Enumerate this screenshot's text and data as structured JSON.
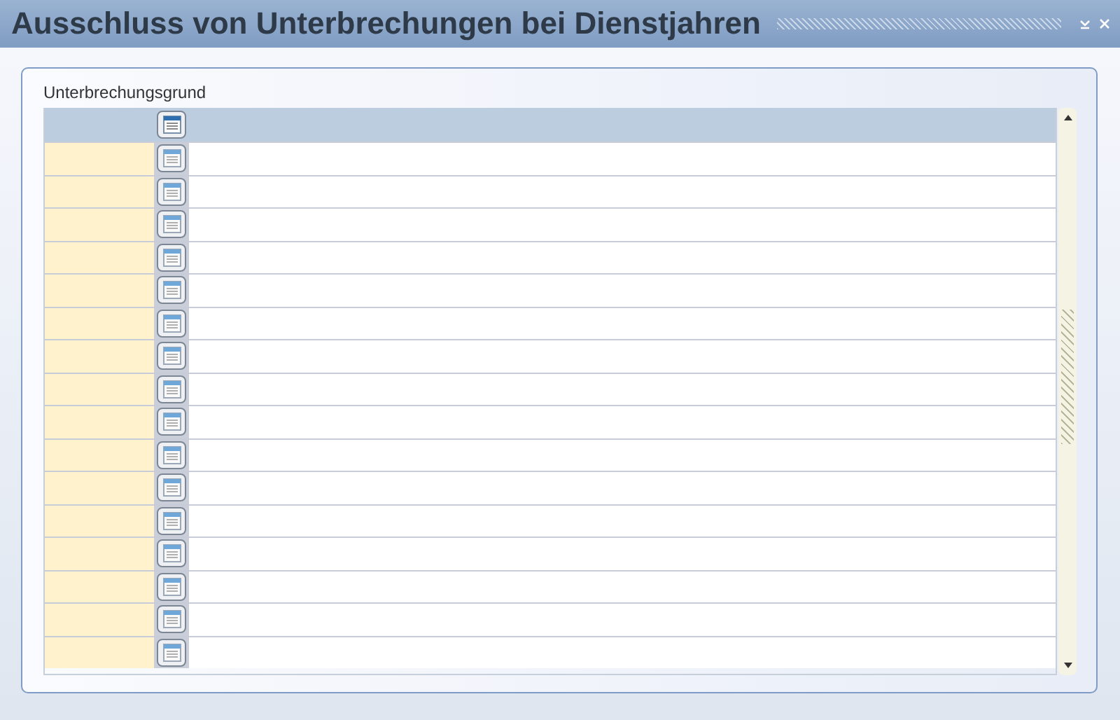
{
  "window": {
    "title": "Ausschluss von Unterbrechungen bei Dienstjahren"
  },
  "section": {
    "label": "Unterbrechungsgrund"
  },
  "table": {
    "rows": [
      {
        "kind": "blank"
      },
      {
        "kind": "blank"
      },
      {
        "kind": "blank"
      },
      {
        "kind": "blank"
      },
      {
        "kind": "blank"
      },
      {
        "kind": "blank"
      },
      {
        "kind": "blank"
      },
      {
        "kind": "blank"
      },
      {
        "kind": "blank"
      },
      {
        "kind": "blank"
      },
      {
        "kind": "blank"
      },
      {
        "kind": "blank"
      },
      {
        "kind": "blank"
      },
      {
        "kind": "blank"
      },
      {
        "kind": "blank"
      },
      {
        "kind": "blank"
      }
    ]
  }
}
